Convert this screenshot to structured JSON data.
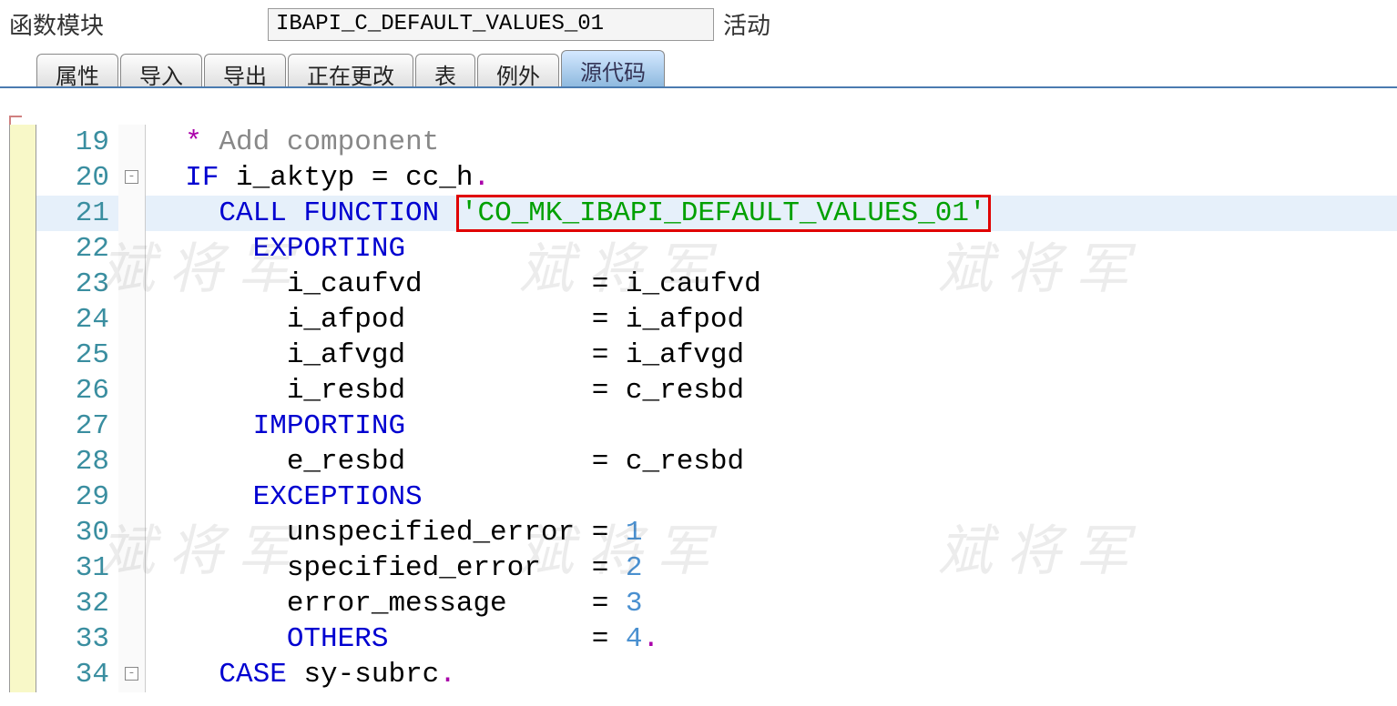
{
  "header": {
    "label": "函数模块",
    "input_value": "IBAPI_C_DEFAULT_VALUES_01",
    "status": "活动"
  },
  "tabs": [
    {
      "label": "属性",
      "active": false
    },
    {
      "label": "导入",
      "active": false
    },
    {
      "label": "导出",
      "active": false
    },
    {
      "label": "正在更改",
      "active": false
    },
    {
      "label": "表",
      "active": false
    },
    {
      "label": "例外",
      "active": false
    },
    {
      "label": "源代码",
      "active": true
    }
  ],
  "code": {
    "lines": [
      {
        "no": "19",
        "fold": "",
        "segs": [
          {
            "t": "txt",
            "v": "  "
          },
          {
            "t": "punct",
            "v": "*"
          },
          {
            "t": "comment",
            "v": " Add component"
          }
        ],
        "hl": false
      },
      {
        "no": "20",
        "fold": "-",
        "segs": [
          {
            "t": "txt",
            "v": "  "
          },
          {
            "t": "kw",
            "v": "IF"
          },
          {
            "t": "txt",
            "v": " i_aktyp "
          },
          {
            "t": "txt",
            "v": "="
          },
          {
            "t": "txt",
            "v": " cc_h"
          },
          {
            "t": "punct",
            "v": "."
          }
        ],
        "hl": false
      },
      {
        "no": "21",
        "fold": "",
        "segs": [
          {
            "t": "txt",
            "v": "    "
          },
          {
            "t": "kw",
            "v": "CALL FUNCTION"
          },
          {
            "t": "txt",
            "v": " "
          },
          {
            "t": "strbox",
            "v": "'CO_MK_IBAPI_DEFAULT_VALUES_01'"
          }
        ],
        "hl": true
      },
      {
        "no": "22",
        "fold": "",
        "segs": [
          {
            "t": "txt",
            "v": "      "
          },
          {
            "t": "kw",
            "v": "EXPORTING"
          }
        ],
        "hl": false
      },
      {
        "no": "23",
        "fold": "",
        "segs": [
          {
            "t": "txt",
            "v": "        i_caufvd          "
          },
          {
            "t": "txt",
            "v": "="
          },
          {
            "t": "txt",
            "v": " i_caufvd"
          }
        ],
        "hl": false
      },
      {
        "no": "24",
        "fold": "",
        "segs": [
          {
            "t": "txt",
            "v": "        i_afpod           "
          },
          {
            "t": "txt",
            "v": "="
          },
          {
            "t": "txt",
            "v": " i_afpod"
          }
        ],
        "hl": false
      },
      {
        "no": "25",
        "fold": "",
        "segs": [
          {
            "t": "txt",
            "v": "        i_afvgd           "
          },
          {
            "t": "txt",
            "v": "="
          },
          {
            "t": "txt",
            "v": " i_afvgd"
          }
        ],
        "hl": false
      },
      {
        "no": "26",
        "fold": "",
        "segs": [
          {
            "t": "txt",
            "v": "        i_resbd           "
          },
          {
            "t": "txt",
            "v": "="
          },
          {
            "t": "txt",
            "v": " c_resbd"
          }
        ],
        "hl": false
      },
      {
        "no": "27",
        "fold": "",
        "segs": [
          {
            "t": "txt",
            "v": "      "
          },
          {
            "t": "kw",
            "v": "IMPORTING"
          }
        ],
        "hl": false
      },
      {
        "no": "28",
        "fold": "",
        "segs": [
          {
            "t": "txt",
            "v": "        e_resbd           "
          },
          {
            "t": "txt",
            "v": "="
          },
          {
            "t": "txt",
            "v": " c_resbd"
          }
        ],
        "hl": false
      },
      {
        "no": "29",
        "fold": "",
        "segs": [
          {
            "t": "txt",
            "v": "      "
          },
          {
            "t": "kw",
            "v": "EXCEPTIONS"
          }
        ],
        "hl": false
      },
      {
        "no": "30",
        "fold": "",
        "segs": [
          {
            "t": "txt",
            "v": "        unspecified_error "
          },
          {
            "t": "txt",
            "v": "="
          },
          {
            "t": "txt",
            "v": " "
          },
          {
            "t": "num",
            "v": "1"
          }
        ],
        "hl": false
      },
      {
        "no": "31",
        "fold": "",
        "segs": [
          {
            "t": "txt",
            "v": "        specified_error   "
          },
          {
            "t": "txt",
            "v": "="
          },
          {
            "t": "txt",
            "v": " "
          },
          {
            "t": "num",
            "v": "2"
          }
        ],
        "hl": false
      },
      {
        "no": "32",
        "fold": "",
        "segs": [
          {
            "t": "txt",
            "v": "        error_message     "
          },
          {
            "t": "txt",
            "v": "="
          },
          {
            "t": "txt",
            "v": " "
          },
          {
            "t": "num",
            "v": "3"
          }
        ],
        "hl": false
      },
      {
        "no": "33",
        "fold": "",
        "segs": [
          {
            "t": "txt",
            "v": "        "
          },
          {
            "t": "kw",
            "v": "OTHERS"
          },
          {
            "t": "txt",
            "v": "            "
          },
          {
            "t": "txt",
            "v": "="
          },
          {
            "t": "txt",
            "v": " "
          },
          {
            "t": "num",
            "v": "4"
          },
          {
            "t": "punct",
            "v": "."
          }
        ],
        "hl": false
      },
      {
        "no": "34",
        "fold": "-",
        "segs": [
          {
            "t": "txt",
            "v": "    "
          },
          {
            "t": "kw",
            "v": "CASE"
          },
          {
            "t": "txt",
            "v": " sy"
          },
          {
            "t": "txt",
            "v": "-"
          },
          {
            "t": "txt",
            "v": "subrc"
          },
          {
            "t": "punct",
            "v": "."
          }
        ],
        "hl": false
      }
    ]
  },
  "watermark": "斌 将 军"
}
